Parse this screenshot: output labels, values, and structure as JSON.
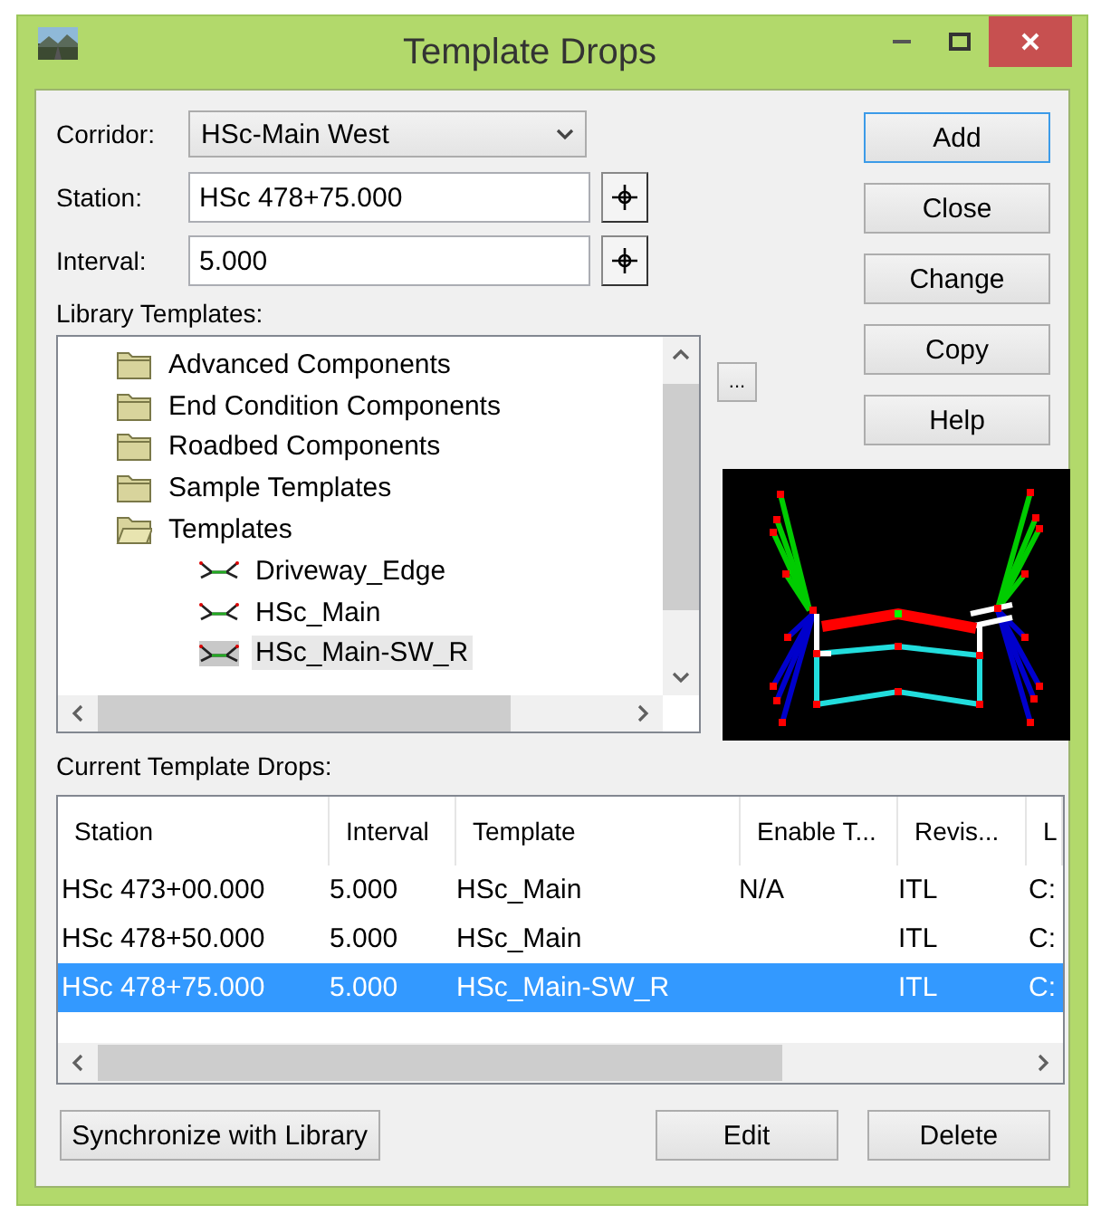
{
  "window": {
    "title": "Template Drops"
  },
  "fields": [
    {
      "kind": "combo",
      "label": "Corridor:",
      "value": "HSc-Main West"
    },
    {
      "kind": "pick",
      "label": "Station:",
      "value": "HSc 478+75.000"
    },
    {
      "kind": "pick",
      "label": "Interval:",
      "value": "5.000"
    }
  ],
  "library": {
    "label": "Library Templates:",
    "browse": "...",
    "items": [
      {
        "kind": "folder",
        "label": "Advanced Components",
        "expanded": false,
        "selected": false
      },
      {
        "kind": "folder",
        "label": "End Condition Components",
        "expanded": false,
        "selected": false
      },
      {
        "kind": "folder",
        "label": "Roadbed Components",
        "expanded": false,
        "selected": false
      },
      {
        "kind": "folder",
        "label": "Sample Templates",
        "expanded": false,
        "selected": false
      },
      {
        "kind": "folder",
        "label": "Templates",
        "expanded": true,
        "selected": false,
        "children": [
          {
            "kind": "template",
            "label": "Driveway_Edge",
            "selected": false
          },
          {
            "kind": "template",
            "label": "HSc_Main",
            "selected": false
          },
          {
            "kind": "template",
            "label": "HSc_Main-SW_R",
            "selected": true
          }
        ]
      }
    ]
  },
  "side_buttons": [
    "Add",
    "Close",
    "Change",
    "Copy",
    "Help"
  ],
  "drops": {
    "label": "Current Template Drops:",
    "columns": [
      "Station",
      "Interval",
      "Template",
      "Enable T...",
      "Revis...",
      "L"
    ],
    "rows": [
      {
        "cells": [
          "HSc 473+00.000",
          "5.000",
          "HSc_Main",
          "N/A",
          "ITL",
          "C:"
        ],
        "selected": false
      },
      {
        "cells": [
          "HSc 478+50.000",
          "5.000",
          "HSc_Main",
          "",
          "ITL",
          "C:"
        ],
        "selected": false
      },
      {
        "cells": [
          "HSc 478+75.000",
          "5.000",
          "HSc_Main-SW_R",
          "",
          "ITL",
          "C:"
        ],
        "selected": true
      }
    ]
  },
  "bottom_buttons": [
    "Synchronize with Library",
    "Edit",
    "Delete"
  ]
}
